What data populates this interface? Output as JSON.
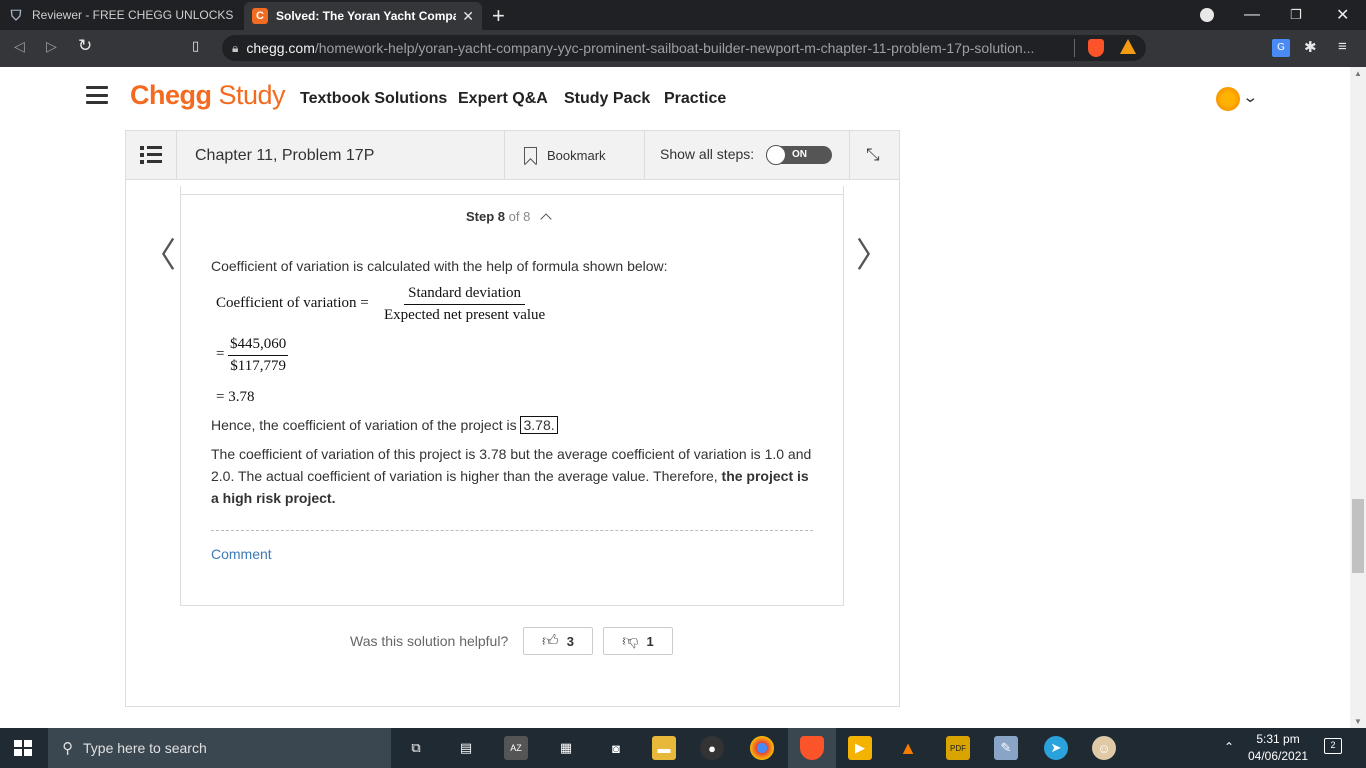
{
  "browser": {
    "tabs": [
      {
        "title": "Reviewer - FREE CHEGG UNLOCKS | Pa"
      },
      {
        "title": "Solved: The Yoran Yacht Company",
        "close": "✕"
      }
    ],
    "new_tab": "+",
    "url_host": "chegg.com",
    "url_path": "/homework-help/yoran-yacht-company-yyc-prominent-sailboat-builder-newport-m-chapter-11-problem-17p-solution..."
  },
  "header": {
    "logo_brand": "Chegg",
    "logo_product": "Study",
    "nav": [
      "Textbook Solutions",
      "Expert Q&A",
      "Study Pack",
      "Practice"
    ]
  },
  "toolbar": {
    "chapter": "Chapter 11, Problem 17P",
    "bookmark": "Bookmark",
    "show_all_steps": "Show all steps:",
    "toggle": "ON"
  },
  "step": {
    "current": "Step 8",
    "of": "of 8"
  },
  "solution": {
    "intro": "Coefficient of variation is calculated with the help of formula shown below:",
    "formula_lhs": "Coefficient of variation =",
    "formula_num": "Standard deviation",
    "formula_den": "Expected net present value",
    "eq_sign": "=",
    "calc_num": "$445,060",
    "calc_den": "$117,779",
    "result_line": "= 3.78",
    "hence_text": "Hence, the coefficient of variation of the project is",
    "hence_value": "3.78.",
    "para_plain": "The coefficient of variation of this project is 3.78 but the average coefficient of variation is 1.0 and 2.0. The actual coefficient of variation is higher than the average value. Therefore,",
    "para_bold": "the project is a high risk project."
  },
  "comment": "Comment",
  "feedback": {
    "question": "Was this solution helpful?",
    "up_count": "3",
    "down_count": "1"
  },
  "taskbar": {
    "search_placeholder": "Type here to search",
    "time": "5:31 pm",
    "date": "04/06/2021",
    "notifications": "2"
  },
  "colors": {
    "chegg_orange": "#f36b21",
    "link_blue": "#3d7ab5",
    "taskbar_bg": "#1f2a33"
  }
}
